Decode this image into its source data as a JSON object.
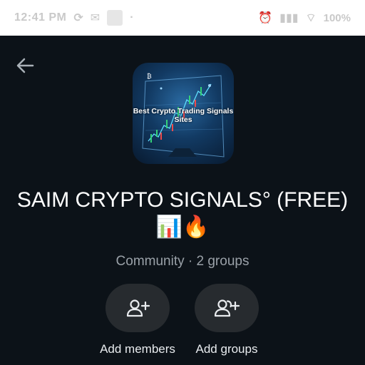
{
  "status_bar": {
    "time": "12:41 PM",
    "battery": "100%"
  },
  "header": {
    "back_icon": "arrow-left-icon"
  },
  "avatar": {
    "heading": "Best Crypto Trading Signals Sites",
    "subtext": "Best Crypto Trading Signals Sites",
    "accent": "#2a6aa2"
  },
  "community": {
    "title": "SAIM CRYPTO SIGNALS° (FREE)📊🔥",
    "subtitle": "Community · 2 groups"
  },
  "actions": [
    {
      "label": "Add members",
      "icon": "add-person-icon"
    },
    {
      "label": "Add groups",
      "icon": "add-group-icon"
    }
  ],
  "colors": {
    "background": "#0c1218",
    "button_bg": "#272b2f",
    "text_primary": "#ffffff",
    "text_secondary": "#9aa1a8"
  }
}
